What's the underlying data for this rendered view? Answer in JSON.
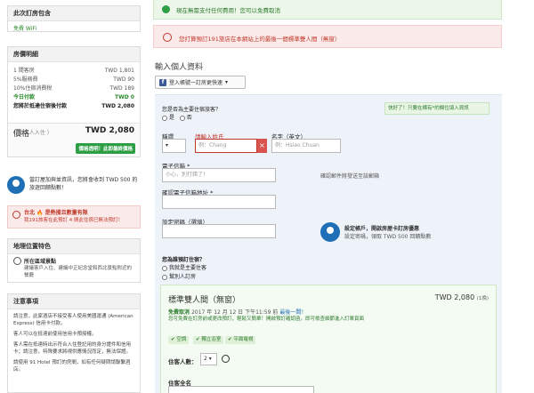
{
  "included": {
    "title": "此次訂房包含",
    "wifi": "免費 WiFi"
  },
  "price": {
    "title": "房價明細",
    "rows": [
      {
        "label": "1 間客房",
        "value": "TWD 1,801"
      },
      {
        "label": "5%服務費",
        "value": "TWD 90"
      },
      {
        "label": "10%住宿消費稅",
        "value": "TWD 189"
      },
      {
        "label": "今日付款",
        "value": "TWD 0"
      },
      {
        "label": "您將於抵達住宿後付款",
        "value": "TWD 2,080"
      }
    ],
    "total_label": "價格",
    "total_amount": "TWD 2,080",
    "total_sub": "( 共 2 人入住 )",
    "badge": "價格透明！此即最終價格"
  },
  "promo": "當訂屋加與並資訊，您將會收到 TWD 500 的旅遊回饋點數！",
  "alert": {
    "title": "台北 🔥 是熱搜且數量有限",
    "text": "我191旅客在此預訂 4 間此住宿已無法預訂！"
  },
  "location": {
    "title": "地理位置特色",
    "feat_title": "所在區域景點",
    "feat_desc": "建議客戶入住、建議中正紀念堂和西北景點附近的餐廳"
  },
  "notes": {
    "title": "注意事項",
    "items": [
      "請注意，此家酒店不接受客人使用美國運通 (American Express) 信用卡付款。",
      "客人可以在抵達前使用信用卡預授權。",
      "客人需在抵達時出示符合入住登記用的身分證件和信用卡；請注意，特殊要求將視供應情況而定，無法保證。",
      "請使用 91 Hotel 預訂的房間，如有任何疑問請聯繫酒店。"
    ]
  },
  "banner": {
    "no_prepay": "現在無需支付任何費用！您可以免費取消",
    "urgent": "您打算預訂191旅店在本網站上的最後一間標準雙人間（無窗）"
  },
  "form": {
    "heading": "輸入個人資料",
    "login": "登入帳號一訂房更快速",
    "q_primary": "您是否為主要住宿旅客？",
    "opt_yes": "是",
    "opt_no": "否",
    "tip": "快好了！只要在標有*的欄位填入資訊",
    "title_label": "稱謂",
    "first_label": "請輸入姓氏",
    "first_placeholder": "例：Chang",
    "last_label": "名字（英文）",
    "last_placeholder": "例：Hsiao Chuan",
    "email_label": "電子信箱 *",
    "email_placeholder": "小心，別打錯了！",
    "email_hint": "確認郵件將發送至該郵箱",
    "confirm_label": "確認電子信箱地址 *",
    "pwd_label": "設定密碼（選填）",
    "account_title": "設定帳戶，開啟房屋卡訂房優惠",
    "account_desc": "設定密碼，領取 TWD 500 回饋點數",
    "q_purpose": "您為誰預訂住宿？",
    "purpose_1": "我就是主要住客",
    "purpose_2": "幫別人訂房"
  },
  "room": {
    "title": "標準雙人間（無窗）",
    "price": "TWD 2,080",
    "nights": "(1晚)",
    "cancel_free": "免費取消",
    "cancel_date": "2017 年 12 月 12 日 下午11:59 前",
    "cancel_link": "最後一間！",
    "desc": "您可免費在訂房前或更改預訂，輕鬆又簡單！開啟預訂確認函，即可檢查細節進入訂單頁面",
    "amenities": [
      "空調",
      "獨立浴室",
      "平面電視"
    ],
    "guests_label": "住客人數：",
    "guests_value": "2",
    "guest_name_label": "住客全名"
  }
}
